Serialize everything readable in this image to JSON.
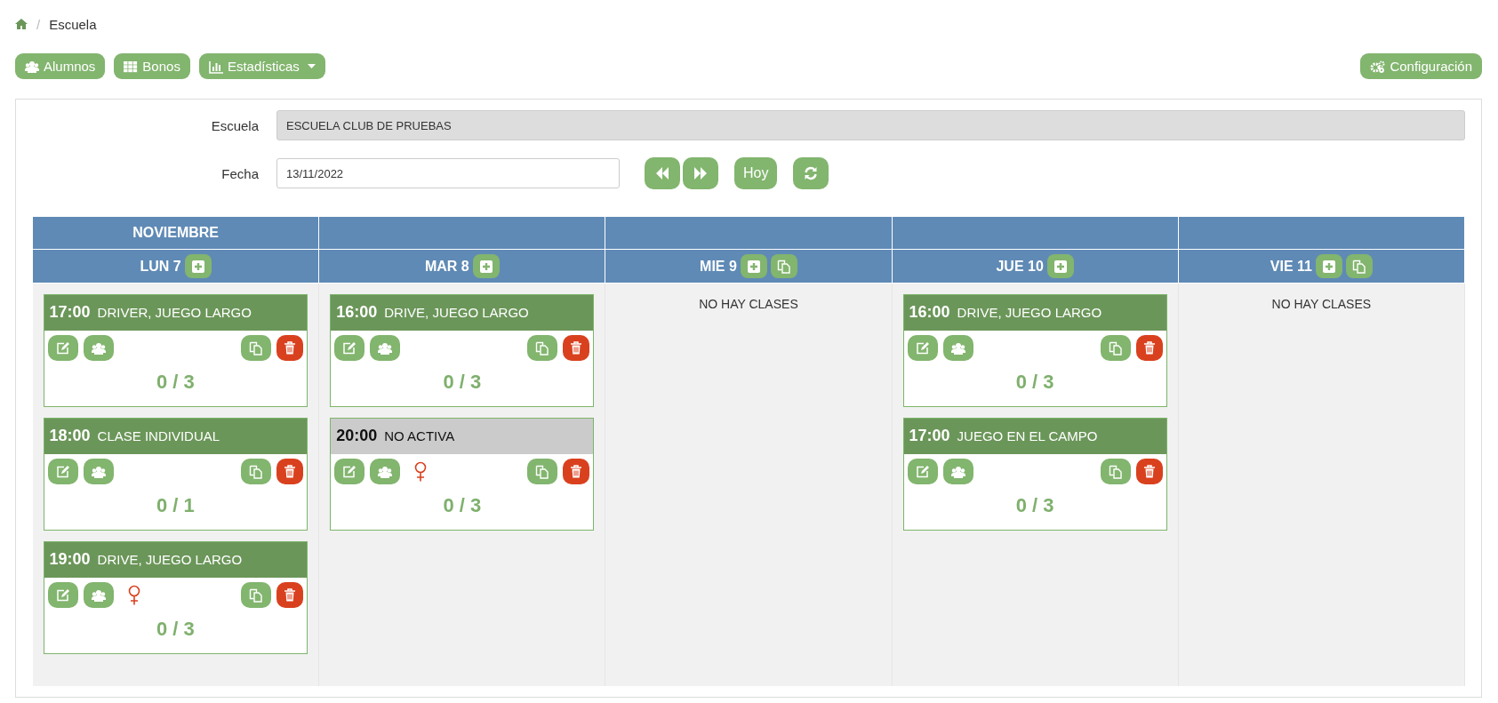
{
  "breadcrumb": {
    "separator": "/",
    "current": "Escuela"
  },
  "toolbar": {
    "buttons": [
      {
        "label": "Alumnos",
        "kind": "users",
        "dropdown": false
      },
      {
        "label": "Bonos",
        "kind": "grid",
        "dropdown": false
      },
      {
        "label": "Estadísticas",
        "kind": "chart",
        "dropdown": true
      }
    ],
    "settings": {
      "label": "Configuración"
    }
  },
  "form": {
    "school": {
      "label": "Escuela",
      "value": "ESCUELA CLUB DE PRUEBAS",
      "disabled": true
    },
    "date": {
      "label": "Fecha",
      "value": "13/11/2022"
    },
    "today_button": "Hoy"
  },
  "calendar": {
    "month": "NOVIEMBRE",
    "days": [
      {
        "label": "LUN 7",
        "copy": false,
        "classes": [
          {
            "time": "17:00",
            "title": "DRIVER, JUEGO LARGO",
            "active": true,
            "female": false,
            "occupancy": "0 / 3"
          },
          {
            "time": "18:00",
            "title": "CLASE INDIVIDUAL",
            "active": true,
            "female": false,
            "occupancy": "0 / 1"
          },
          {
            "time": "19:00",
            "title": "DRIVE, JUEGO LARGO",
            "active": true,
            "female": true,
            "occupancy": "0 / 3"
          }
        ]
      },
      {
        "label": "MAR 8",
        "copy": false,
        "classes": [
          {
            "time": "16:00",
            "title": "DRIVE, JUEGO LARGO",
            "active": true,
            "female": false,
            "occupancy": "0 / 3"
          },
          {
            "time": "20:00",
            "title": "NO ACTIVA",
            "active": false,
            "female": true,
            "occupancy": "0 / 3"
          }
        ]
      },
      {
        "label": "MIE 9",
        "copy": true,
        "empty_message": "NO HAY CLASES"
      },
      {
        "label": "JUE 10",
        "copy": false,
        "classes": [
          {
            "time": "16:00",
            "title": "DRIVE, JUEGO LARGO",
            "active": true,
            "female": false,
            "occupancy": "0 / 3"
          },
          {
            "time": "17:00",
            "title": "JUEGO EN EL CAMPO",
            "active": true,
            "female": false,
            "occupancy": "0 / 3"
          }
        ]
      },
      {
        "label": "VIE 11",
        "copy": true,
        "empty_message": "NO HAY CLASES"
      }
    ]
  }
}
